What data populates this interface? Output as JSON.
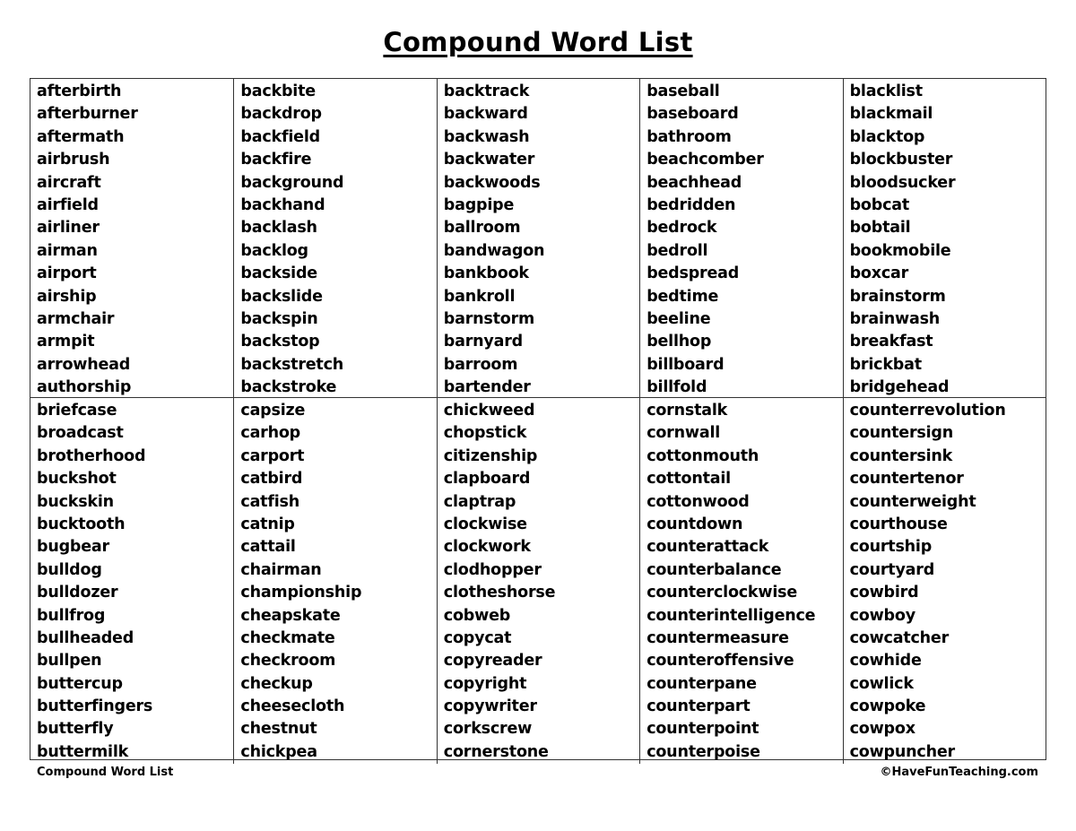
{
  "title": "Compound Word List",
  "sections": [
    {
      "columns": [
        [
          "afterbirth",
          "afterburner",
          "aftermath",
          "airbrush",
          "aircraft",
          "airfield",
          "airliner",
          "airman",
          "airport",
          "airship",
          "armchair",
          "armpit",
          "arrowhead",
          "authorship"
        ],
        [
          "backbite",
          "backdrop",
          "backfield",
          "backfire",
          "background",
          "backhand",
          "backlash",
          "backlog",
          "backside",
          "backslide",
          "backspin",
          "backstop",
          "backstretch",
          "backstroke"
        ],
        [
          "backtrack",
          "backward",
          "backwash",
          "backwater",
          "backwoods",
          "bagpipe",
          "ballroom",
          "bandwagon",
          "bankbook",
          "bankroll",
          "barnstorm",
          "barnyard",
          "barroom",
          "bartender"
        ],
        [
          "baseball",
          "baseboard",
          "bathroom",
          "beachcomber",
          "beachhead",
          "bedridden",
          "bedrock",
          "bedroll",
          "bedspread",
          "bedtime",
          "beeline",
          "bellhop",
          "billboard",
          "billfold"
        ],
        [
          "blacklist",
          "blackmail",
          "blacktop",
          "blockbuster",
          "bloodsucker",
          "bobcat",
          "bobtail",
          "bookmobile",
          "boxcar",
          "brainstorm",
          "brainwash",
          "breakfast",
          "brickbat",
          "bridgehead"
        ]
      ]
    },
    {
      "columns": [
        [
          "briefcase",
          "broadcast",
          "brotherhood",
          "buckshot",
          "buckskin",
          "bucktooth",
          "bugbear",
          "bulldog",
          "bulldozer",
          "bullfrog",
          "bullheaded",
          "bullpen",
          "buttercup",
          "butterfingers",
          "butterfly",
          "buttermilk"
        ],
        [
          "capsize",
          "carhop",
          "carport",
          "catbird",
          "catfish",
          "catnip",
          "cattail",
          "chairman",
          "championship",
          "cheapskate",
          "checkmate",
          "checkroom",
          "checkup",
          "cheesecloth",
          "chestnut",
          "chickpea"
        ],
        [
          "chickweed",
          "chopstick",
          "citizenship",
          "clapboard",
          "claptrap",
          "clockwise",
          "clockwork",
          "clodhopper",
          "clotheshorse",
          "cobweb",
          "copycat",
          "copyreader",
          "copyright",
          "copywriter",
          "corkscrew",
          "cornerstone"
        ],
        [
          "cornstalk",
          "cornwall",
          "cottonmouth",
          "cottontail",
          "cottonwood",
          "countdown",
          "counterattack",
          "counterbalance",
          "counterclockwise",
          "counterintelligence",
          "countermeasure",
          "counteroffensive",
          "counterpane",
          "counterpart",
          "counterpoint",
          "counterpoise"
        ],
        [
          "counterrevolution",
          "countersign",
          "countersink",
          "countertenor",
          "counterweight",
          "courthouse",
          "courtship",
          "courtyard",
          "cowbird",
          "cowboy",
          "cowcatcher",
          "cowhide",
          "cowlick",
          "cowpoke",
          "cowpox",
          "cowpuncher"
        ]
      ]
    }
  ],
  "footer": {
    "left": "Compound Word List",
    "right": "©HaveFunTeaching.com"
  }
}
